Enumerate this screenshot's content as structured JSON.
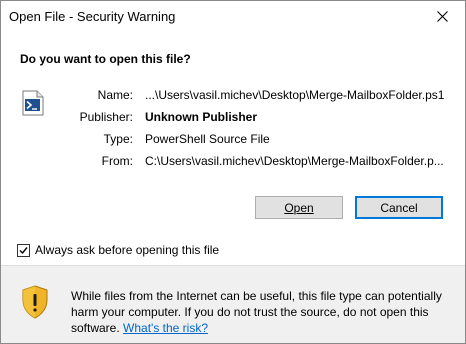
{
  "window": {
    "title": "Open File - Security Warning",
    "close_icon": "close-icon"
  },
  "question": "Do you want to open this file?",
  "file_icon": "powershell-file-icon",
  "info": {
    "name_label": "Name:",
    "name_value": "...\\Users\\vasil.michev\\Desktop\\Merge-MailboxFolder.ps1",
    "publisher_label": "Publisher:",
    "publisher_value": "Unknown Publisher",
    "type_label": "Type:",
    "type_value": "PowerShell Source File",
    "from_label": "From:",
    "from_value": "C:\\Users\\vasil.michev\\Desktop\\Merge-MailboxFolder.p..."
  },
  "buttons": {
    "open_label": "Open",
    "cancel_label": "Cancel"
  },
  "checkbox": {
    "label": "Always ask before opening this file",
    "checked": true
  },
  "warning": {
    "icon": "shield-warning-icon",
    "text": "While files from the Internet can be useful, this file type can potentially harm your computer. If you do not trust the source, do not open this software.",
    "link_text": "What's the risk?"
  },
  "colors": {
    "accent": "#0078d7",
    "link": "#0066cc",
    "dialog_bg": "#f0f0f0"
  }
}
